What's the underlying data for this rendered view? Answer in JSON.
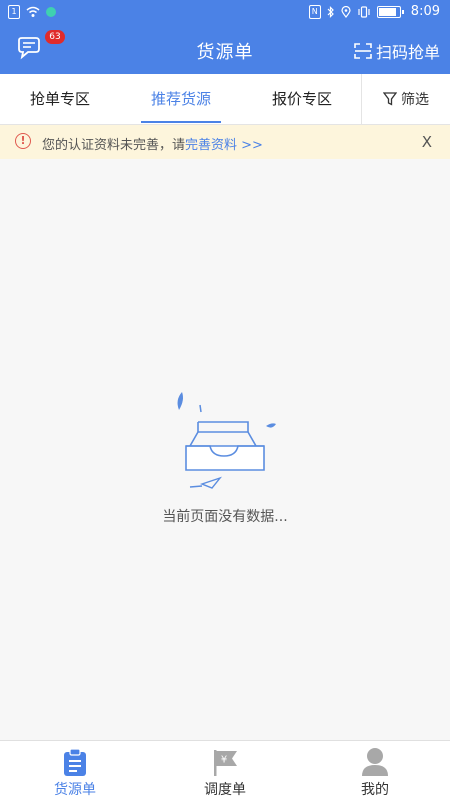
{
  "status_bar": {
    "time": "8:09",
    "sim_label": "1",
    "battery_level": 0.85
  },
  "header": {
    "title": "货源单",
    "message_badge": "63",
    "scan_label": "扫码抢单",
    "message_icon": "chat-bubble-icon",
    "scan_icon": "scan-frame-icon"
  },
  "tabs": [
    {
      "label": "抢单专区",
      "active": false
    },
    {
      "label": "推荐货源",
      "active": true
    },
    {
      "label": "报价专区",
      "active": false
    }
  ],
  "filter": {
    "label": "筛选",
    "icon": "funnel-icon"
  },
  "notice": {
    "icon_glyph": "!",
    "text": "您的认证资料未完善，请",
    "link_text": "完善资料 >>",
    "close_label": "X"
  },
  "empty_state": {
    "message": "当前页面没有数据..."
  },
  "bottom_nav": [
    {
      "label": "货源单",
      "icon": "clipboard-list-icon",
      "active": true
    },
    {
      "label": "调度单",
      "icon": "yen-flag-icon",
      "active": false
    },
    {
      "label": "我的",
      "icon": "user-icon",
      "active": false
    }
  ],
  "colors": {
    "primary": "#4b82e6",
    "notice_bg": "#fdf5dc",
    "badge": "#e02b2b",
    "inactive_icon": "#a8a8a8"
  }
}
